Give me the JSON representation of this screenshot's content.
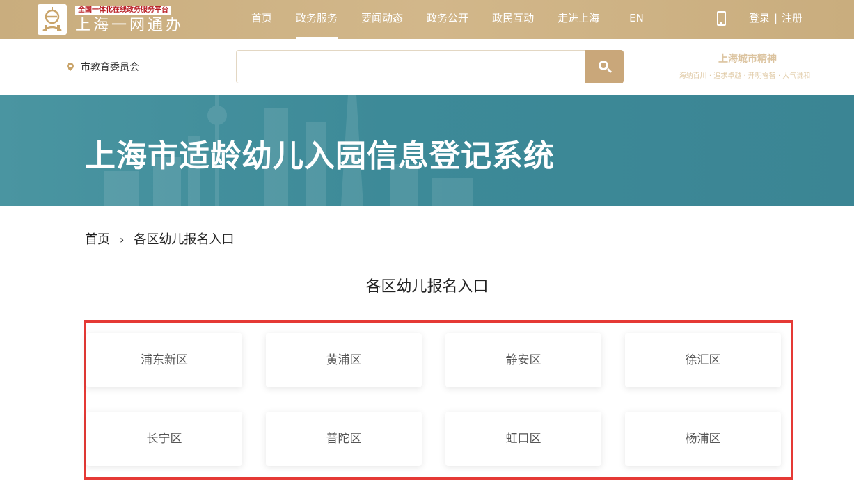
{
  "header": {
    "logo_tagline": "全国一体化在线政务服务平台",
    "logo_title": "上海一网通办",
    "nav": [
      "首页",
      "政务服务",
      "要闻动态",
      "政务公开",
      "政民互动",
      "走进上海",
      "EN"
    ],
    "active_nav": "政务服务",
    "login_label": "登录",
    "register_label": "注册",
    "login_separator": "|"
  },
  "search": {
    "location": "市教育委员会",
    "placeholder": "",
    "value": ""
  },
  "spirit": {
    "title": "上海城市精神",
    "subtitle": "海纳百川 · 追求卓越 · 开明睿智 · 大气谦和"
  },
  "banner": {
    "title": "上海市适龄幼儿入园信息登记系统"
  },
  "breadcrumb": {
    "home": "首页",
    "separator": "›",
    "current": "各区幼儿报名入口"
  },
  "section": {
    "title": "各区幼儿报名入口"
  },
  "districts": [
    "浦东新区",
    "黄浦区",
    "静安区",
    "徐汇区",
    "长宁区",
    "普陀区",
    "虹口区",
    "杨浦区"
  ],
  "colors": {
    "topbar": "#c9ad7e",
    "accent": "#c9a77a",
    "banner": "#3d8a98",
    "highlight_frame": "#e53935"
  }
}
